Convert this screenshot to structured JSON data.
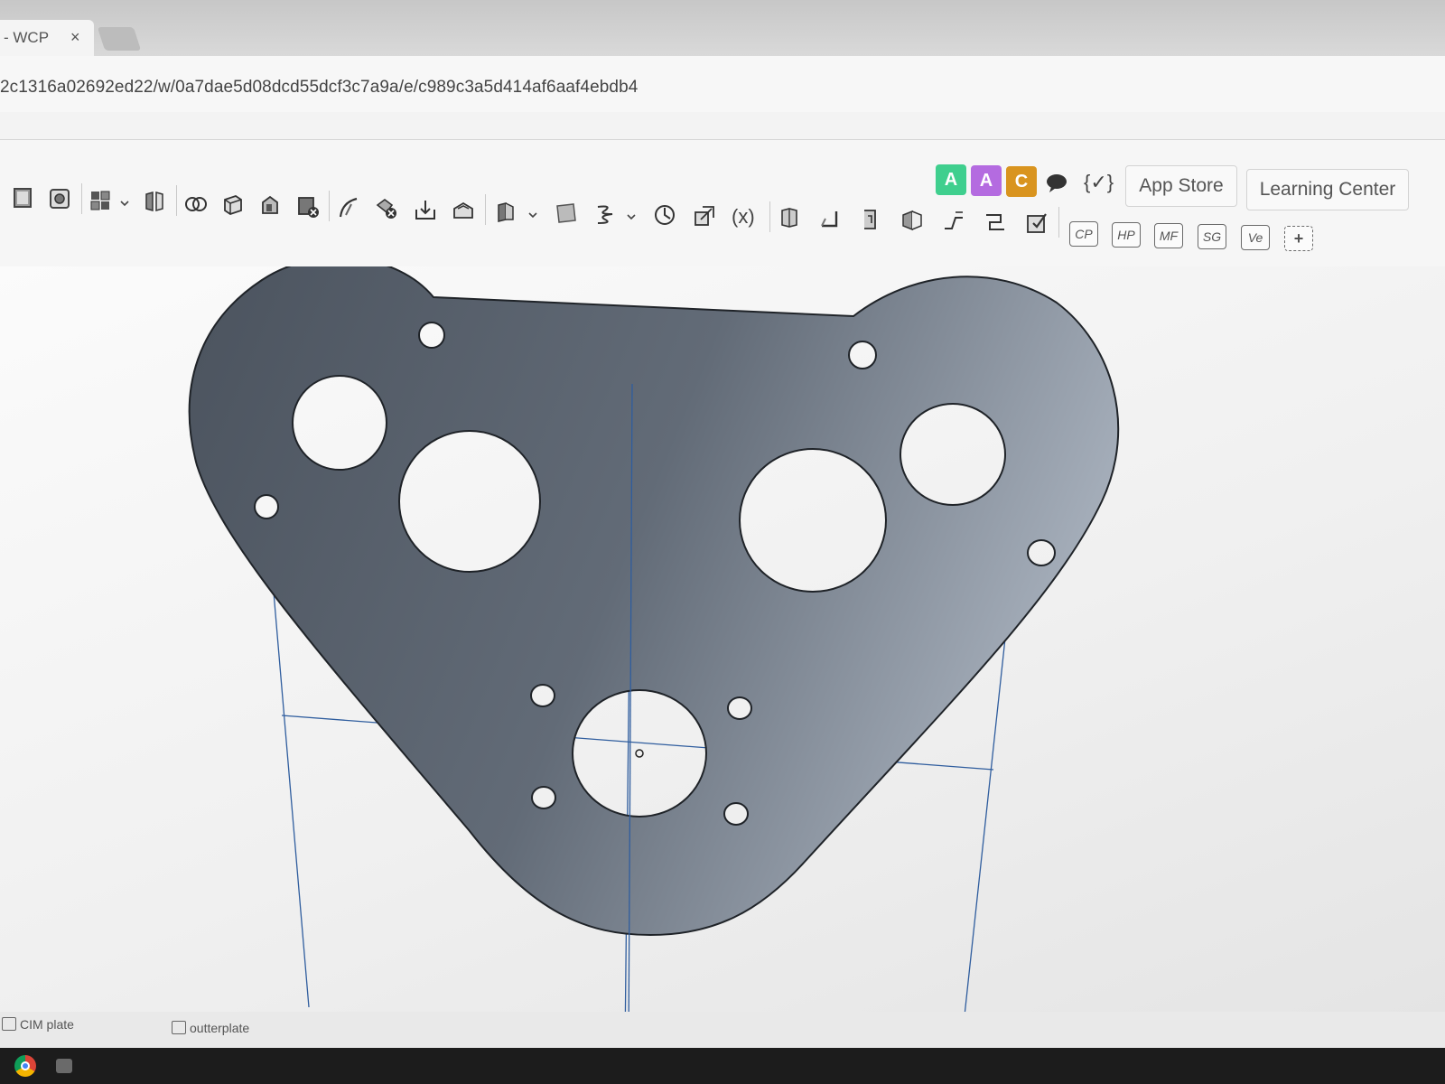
{
  "browser": {
    "tab_title": "- WCP",
    "tab_close": "×",
    "url": "2c1316a02692ed22/w/0a7dae5d08dcd55dcf3c7a9a/e/c989c3a5d414af6aaf4ebdb4"
  },
  "toolbar": {
    "icons": [
      "sketch-icon",
      "extrude-icon",
      "pattern-icon",
      "mirror-icon",
      "boolean-icon",
      "shell-icon",
      "draft-icon",
      "delete-part-icon",
      "fillet-icon",
      "chamfer-icon",
      "move-face-icon",
      "offset-surface-icon",
      "plane-icon",
      "mate-connector-icon",
      "helix-icon",
      "measure-icon",
      "transform-icon",
      "variable-icon",
      "sheet-metal-icon",
      "flange-icon",
      "hem-icon",
      "tab-icon",
      "bend-icon",
      "jog-icon",
      "corner-icon",
      "finish-icon"
    ],
    "variable_label": "(x)",
    "custom_features": [
      "CP",
      "HP",
      "MF",
      "SG",
      "Ve"
    ],
    "add_custom_label": "+",
    "collaborators": [
      {
        "initial": "A",
        "color": "#3fcf8e"
      },
      {
        "initial": "A",
        "color": "#b46be0"
      },
      {
        "initial": "C",
        "color": "#d9941f"
      }
    ],
    "comment_icon": "comment-icon",
    "featurescript_label": "{✓}",
    "app_store_label": "App Store",
    "learning_center_label": "Learning Center"
  },
  "canvas": {
    "part_color": "#4e5662",
    "hole_color": "#f4f4f4",
    "sketch_line_color": "#2f5d9e"
  },
  "bottom_tabs": [
    {
      "label": "CIM plate"
    },
    {
      "label": "outterplate"
    }
  ]
}
